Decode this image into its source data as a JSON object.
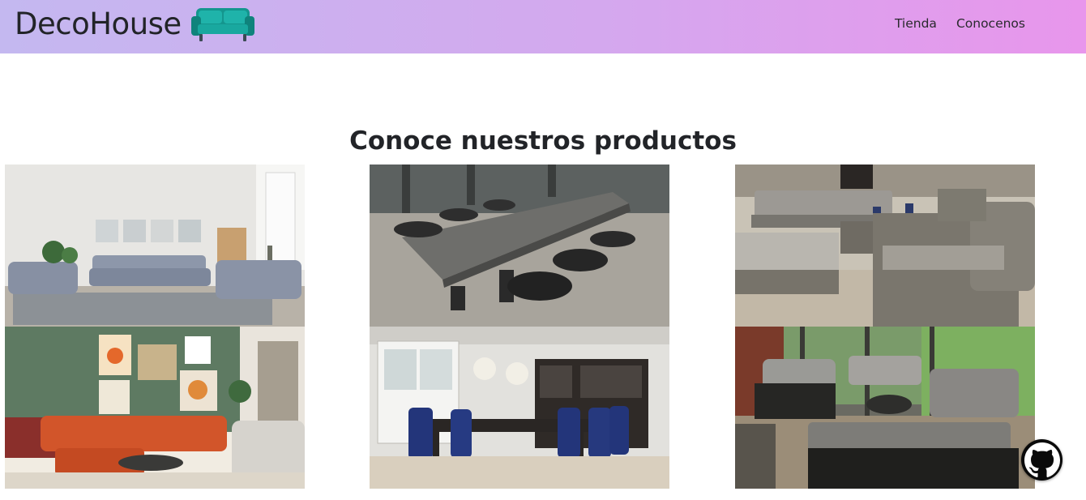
{
  "header": {
    "brand": "DecoHouse",
    "brand_icon": "sofa-icon",
    "nav": [
      {
        "label": "Tienda"
      },
      {
        "label": "Conocenos"
      }
    ]
  },
  "main": {
    "title": "Conoce nuestros productos"
  },
  "floating": {
    "icon": "github-icon"
  },
  "colors": {
    "navbar_gradient_start": "#c4b8f0",
    "navbar_gradient_end": "#e896ec",
    "sofa_icon": "#16a29a",
    "github_button_bg": "#0a0a0a",
    "text": "#222428"
  }
}
